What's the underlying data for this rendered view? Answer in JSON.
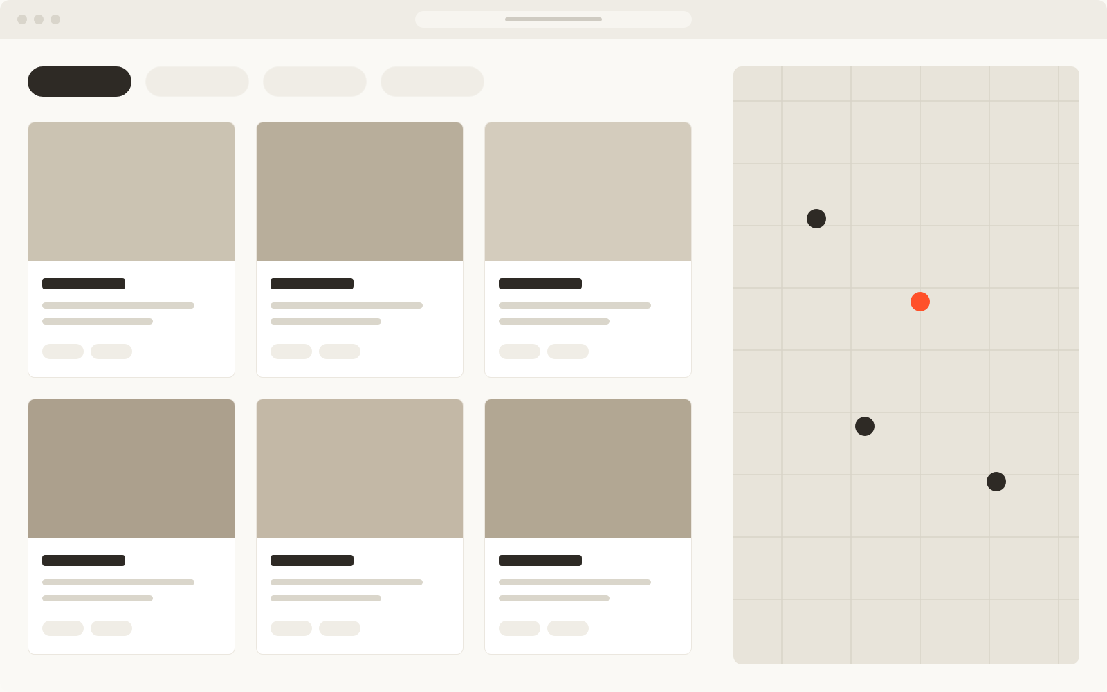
{
  "window": {
    "traffic_lights": [
      "close",
      "minimize",
      "maximize"
    ],
    "address_bar": ""
  },
  "tabs": [
    {
      "label": "",
      "active": true
    },
    {
      "label": "",
      "active": false
    },
    {
      "label": "",
      "active": false
    },
    {
      "label": "",
      "active": false
    }
  ],
  "cards": [
    {
      "title": "",
      "line1": "",
      "line2": "",
      "tags": [
        "",
        ""
      ],
      "image_color": "#cbc3b2"
    },
    {
      "title": "",
      "line1": "",
      "line2": "",
      "tags": [
        "",
        ""
      ],
      "image_color": "#b8ae9b"
    },
    {
      "title": "",
      "line1": "",
      "line2": "",
      "tags": [
        "",
        ""
      ],
      "image_color": "#d4ccbd"
    },
    {
      "title": "",
      "line1": "",
      "line2": "",
      "tags": [
        "",
        ""
      ],
      "image_color": "#aca08d"
    },
    {
      "title": "",
      "line1": "",
      "line2": "",
      "tags": [
        "",
        ""
      ],
      "image_color": "#c3b8a6"
    },
    {
      "title": "",
      "line1": "",
      "line2": "",
      "tags": [
        "",
        ""
      ],
      "image_color": "#b2a793"
    }
  ],
  "map": {
    "markers": [
      {
        "name": "map-marker",
        "color": "#2e2a25",
        "selected": false
      },
      {
        "name": "map-marker-selected",
        "color": "#ff5029",
        "selected": true
      },
      {
        "name": "map-marker",
        "color": "#2e2a25",
        "selected": false
      },
      {
        "name": "map-marker",
        "color": "#2e2a25",
        "selected": false
      }
    ]
  },
  "colors": {
    "accent": "#ff5029",
    "dark": "#2e2a25",
    "background": "#faf9f5"
  }
}
